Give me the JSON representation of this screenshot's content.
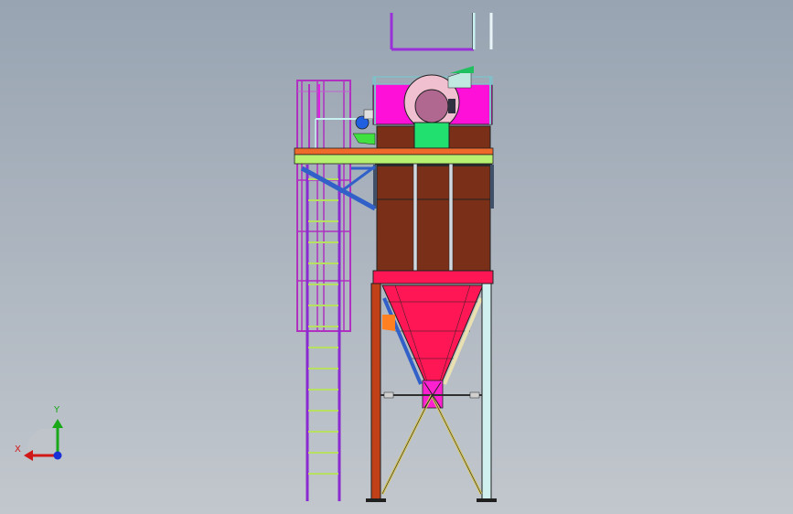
{
  "viewport": {
    "background_top": "#98a4b2",
    "background_bottom": "#c2c7cd"
  },
  "axis_triad": {
    "x_label": "X",
    "y_label": "Y",
    "x_color": "#d01818",
    "y_color": "#18a818",
    "z_color": "#1830d8"
  },
  "model": {
    "name": "dust-collector-silo-assembly",
    "colors": {
      "hopper": "#ff1654",
      "housing": "#7a3018",
      "housing_rib": "#d0d8e0",
      "fan_box": "#ff10d8",
      "motor_block": "#22e070",
      "fan_casing": "#f0c0d0",
      "platform_orange": "#ee6a2a",
      "platform_green": "#b8f070",
      "frame_rail": "#d81860",
      "leg_left": "#c04018",
      "leg_right": "#d0f0f0",
      "ladder": "#8a2ad0",
      "ladder_rung": "#b8e060",
      "cage": "#b030c0",
      "brace": "#3060c8",
      "cross_brace": "#d8c860",
      "orange_bracket": "#ff8020",
      "blue_part": "#2060e0",
      "outline": "#202020"
    }
  }
}
